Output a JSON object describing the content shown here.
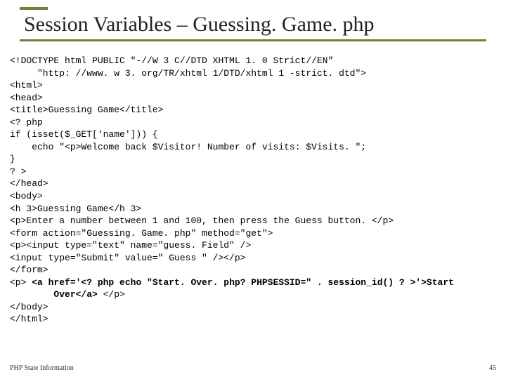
{
  "slide": {
    "title": "Session Variables – Guessing. Game. php",
    "footer_left": "PHP State Information",
    "footer_right": "45"
  },
  "code": {
    "l01": "<!DOCTYPE html PUBLIC \"-//W 3 C//DTD XHTML 1. 0 Strict//EN\"",
    "l02": "     \"http: //www. w 3. org/TR/xhtml 1/DTD/xhtml 1 -strict. dtd\">",
    "l03": "<html>",
    "l04": "<head>",
    "l05": "<title>Guessing Game</title>",
    "l06": "<? php",
    "l07": "if (isset($_GET['name'])) {",
    "l08": "    echo \"<p>Welcome back $Visitor! Number of visits: $Visits. \";",
    "l09": "}",
    "l10": "? >",
    "l11": "</head>",
    "l12": "<body>",
    "l13": "<h 3>Guessing Game</h 3>",
    "l14": "<p>Enter a number between 1 and 100, then press the Guess button. </p>",
    "l15": "<form action=\"Guessing. Game. php\" method=\"get\">",
    "l16": "<p><input type=\"text\" name=\"guess. Field\" />",
    "l17": "<input type=\"Submit\" value=\" Guess \" /></p>",
    "l18": "</form>",
    "l19a": "<p> ",
    "l19b": "<a href='<? php echo \"Start. Over. php? PHPSESSID=\" . session_id() ? >'>Start",
    "l20a": "        Over</a>",
    "l20b": " </p>",
    "l21": "</body>",
    "l22": "</html>"
  }
}
